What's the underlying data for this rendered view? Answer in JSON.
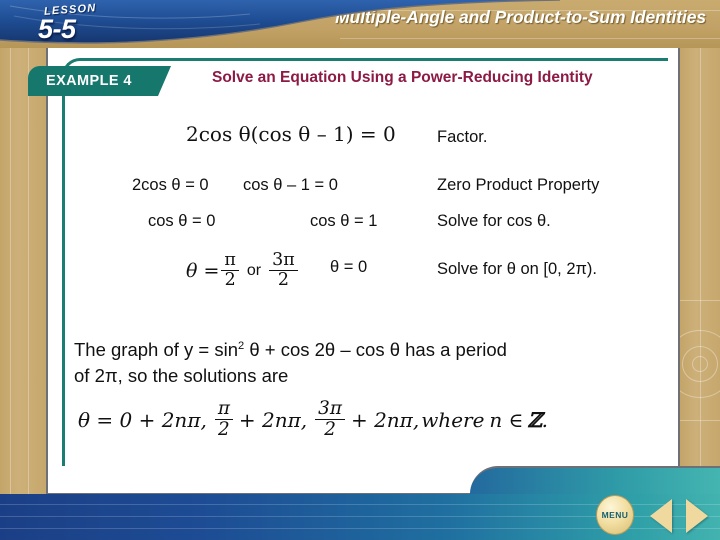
{
  "header": {
    "lesson_label": "LESSON",
    "lesson_number": "5-5",
    "title": "Multiple-Angle and Product-to-Sum Identities"
  },
  "example": {
    "tab_label": "EXAMPLE 4",
    "title": "Solve an Equation Using a Power-Reducing Identity"
  },
  "work": {
    "equation_factored": "2cos θ(cos θ – 1) = 0",
    "row2_left": "2cos θ = 0",
    "row2_right": "cos θ – 1 = 0",
    "row3_left": "cos θ = 0",
    "row3_right": "cos θ = 1",
    "row4_left_prefix": "θ =",
    "row4_frac1_num": "π",
    "row4_frac1_den": "2",
    "row4_or": "or",
    "row4_frac2_num": "3π",
    "row4_frac2_den": "2",
    "row4_right": "θ = 0",
    "note_factor": "Factor.",
    "note_zero_product": "Zero Product Property",
    "note_solve_cos": "Solve for cos θ.",
    "note_solve_interval": "Solve for θ on [0, 2π)."
  },
  "paragraph": {
    "line1_a": "The graph of y = sin",
    "line1_sup": "2",
    "line1_b": " θ + cos 2θ – cos θ has a period",
    "line2": "of 2π, so the solutions are"
  },
  "solution": {
    "prefix": "θ = 0 + 2nπ,",
    "frac1_num": "π",
    "frac1_den": "2",
    "term1_suffix": "+ 2nπ,",
    "frac2_num": "3π",
    "frac2_den": "2",
    "term2_suffix": "+ 2nπ,",
    "where_word": "where",
    "condition": "n ∈",
    "blackboard_z": "ℤ",
    "period": "."
  },
  "footer": {
    "menu_label": "MENU",
    "prev_icon": "left-triangle-icon",
    "next_icon": "right-triangle-icon"
  },
  "colors": {
    "teal": "#16776d",
    "maroon": "#8c1a45",
    "tan": "#c2a266",
    "blue": "#1b3f86"
  }
}
